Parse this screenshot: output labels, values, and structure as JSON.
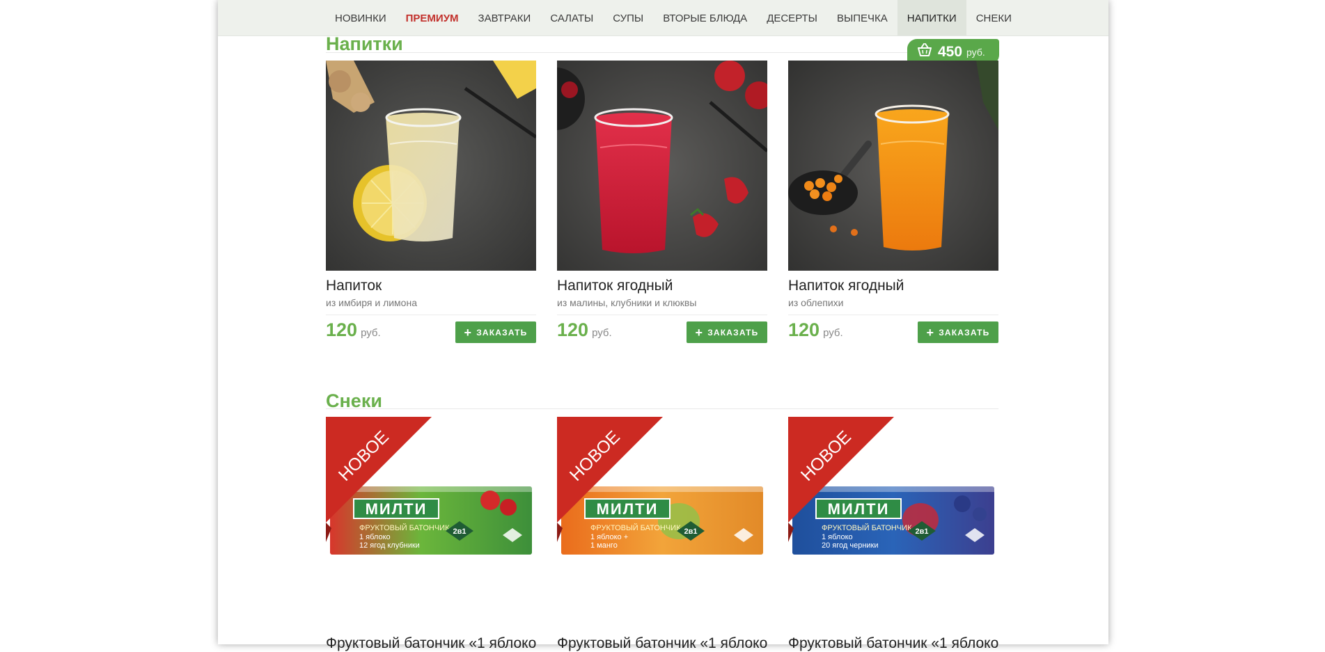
{
  "nav": {
    "items": [
      {
        "label": "НОВИНКИ"
      },
      {
        "label": "ПРЕМИУМ"
      },
      {
        "label": "ЗАВТРАКИ"
      },
      {
        "label": "САЛАТЫ"
      },
      {
        "label": "СУПЫ"
      },
      {
        "label": "ВТОРЫЕ БЛЮДА"
      },
      {
        "label": "ДЕСЕРТЫ"
      },
      {
        "label": "ВЫПЕЧКА"
      },
      {
        "label": "НАПИТКИ"
      },
      {
        "label": "СНЕКИ"
      }
    ],
    "active": "НАПИТКИ",
    "highlight": "ПРЕМИУМ"
  },
  "cart": {
    "icon": "basket-icon",
    "total": "450",
    "currency": "руб."
  },
  "drinks": {
    "title": "Напитки",
    "products": [
      {
        "name": "Напиток",
        "desc": "из имбиря и лимона",
        "price": "120",
        "currency": "руб.",
        "button": "ЗАКАЗАТЬ"
      },
      {
        "name": "Напиток ягодный",
        "desc": "из малины, клубники и клюквы",
        "price": "120",
        "currency": "руб.",
        "button": "ЗАКАЗАТЬ"
      },
      {
        "name": "Напиток ягодный",
        "desc": "из облепихи",
        "price": "120",
        "currency": "руб.",
        "button": "ЗАКАЗАТЬ"
      }
    ]
  },
  "snacks": {
    "title": "Снеки",
    "products": [
      {
        "ribbon": "НОВОЕ",
        "brand": "МИЛТИ",
        "subtitle": "ФРУКТОВЫЙ БАТОНЧИК",
        "line1": "1 яблоко",
        "line2": "12 ягод клубники",
        "badge": "2в1",
        "name": "Фруктовый батончик «1 яблоко"
      },
      {
        "ribbon": "НОВОЕ",
        "brand": "МИЛТИ",
        "subtitle": "ФРУКТОВЫЙ БАТОНЧИК",
        "line1": "1 яблоко +",
        "line2": "1 манго",
        "badge": "2в1",
        "name": "Фруктовый батончик «1 яблоко"
      },
      {
        "ribbon": "НОВОЕ",
        "brand": "МИЛТИ",
        "subtitle": "ФРУКТОВЫЙ БАТОНЧИК",
        "line1": "1 яблоко",
        "line2": "20 ягод черники",
        "badge": "2в1",
        "name": "Фруктовый батончик «1 яблоко"
      }
    ]
  },
  "colors": {
    "accent_green": "#6ab04c",
    "button_green": "#4ea04a",
    "premium_red": "#c2302b",
    "ribbon_red": "#cc2a22"
  }
}
